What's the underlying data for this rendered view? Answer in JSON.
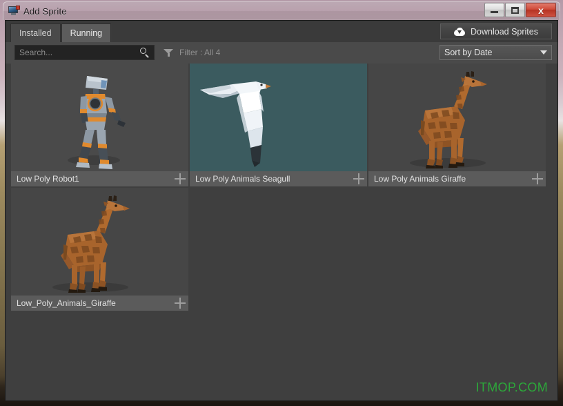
{
  "window": {
    "title": "Add Sprite",
    "icon": "computer-monitor-icon",
    "caption": {
      "minimize_label": "–",
      "maximize_label": "❐",
      "close_label": "x"
    }
  },
  "tabs": [
    {
      "label": "Installed",
      "active": false
    },
    {
      "label": "Running",
      "active": true
    }
  ],
  "toolbar": {
    "download_label": "Download Sprites",
    "download_icon": "cloud-download-icon"
  },
  "search": {
    "placeholder": "Search...",
    "value": "",
    "icon": "search-icon"
  },
  "filter": {
    "icon": "funnel-icon",
    "label": "Filter : All 4"
  },
  "sort": {
    "selected": "Sort by Date",
    "caret_icon": "chevron-down-icon"
  },
  "sprites": [
    {
      "name": "Low Poly Robot1",
      "bg": "#4a4a4a",
      "add_icon": "plus-icon",
      "art": "robot"
    },
    {
      "name": "Low Poly Animals Seagull",
      "bg": "#3b5b5f",
      "add_icon": "plus-icon",
      "art": "seagull"
    },
    {
      "name": "Low Poly Animals Giraffe",
      "bg": "#464646",
      "add_icon": "plus-icon",
      "art": "giraffe"
    },
    {
      "name": "Low_Poly_Animals_Giraffe",
      "bg": "#464646",
      "add_icon": "plus-icon",
      "art": "giraffe"
    }
  ],
  "watermark": {
    "text": "ITMOP.COM",
    "color": "#2ca83a"
  }
}
